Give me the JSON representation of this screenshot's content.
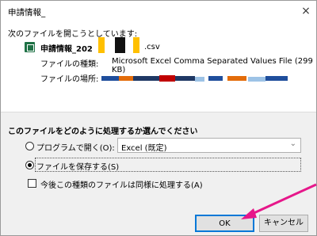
{
  "window": {
    "title": "申請情報_",
    "close_glyph": "×"
  },
  "intro": "次のファイルを開こうとしています:",
  "file": {
    "name_prefix": "申請情報_202",
    "extension": ".csv",
    "type_label": "ファイルの種類:",
    "type_value": "Microsoft Excel Comma Separated Values File (299 KB)",
    "location_label": "ファイルの場所:"
  },
  "prompt": "このファイルをどのように処理するか選んでください",
  "options": {
    "open_with_label": "プログラムで開く(O):",
    "open_with_program": "Excel (既定)",
    "save_label": "ファイルを保存する(S)",
    "remember_label": "今後この種類のファイルは同様に処理する(A)"
  },
  "buttons": {
    "ok": "OK",
    "cancel": "キャンセル"
  },
  "colors": {
    "accent": "#0078d7",
    "arrow": "#e6178a"
  }
}
